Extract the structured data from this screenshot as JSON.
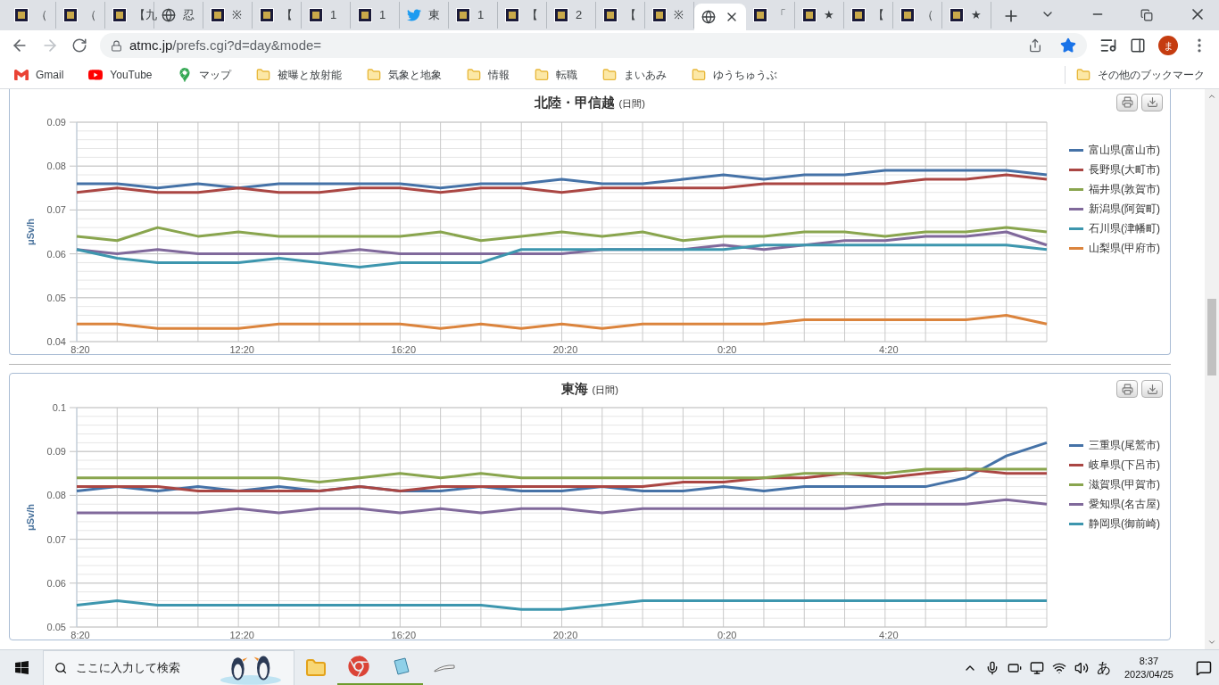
{
  "tabs": [
    {
      "kind": "site",
      "label": "（",
      "selected": false
    },
    {
      "kind": "site",
      "label": "（",
      "selected": false
    },
    {
      "kind": "site",
      "label": "【九",
      "selected": false
    },
    {
      "kind": "globe",
      "label": "忍",
      "selected": false
    },
    {
      "kind": "site",
      "label": "※",
      "selected": false
    },
    {
      "kind": "site",
      "label": "【",
      "selected": false
    },
    {
      "kind": "site",
      "label": "1",
      "selected": false
    },
    {
      "kind": "site",
      "label": "1",
      "selected": false
    },
    {
      "kind": "bird",
      "label": "東",
      "selected": false
    },
    {
      "kind": "site",
      "label": "1",
      "selected": false
    },
    {
      "kind": "site",
      "label": "【",
      "selected": false
    },
    {
      "kind": "site",
      "label": "2",
      "selected": false
    },
    {
      "kind": "site",
      "label": "【",
      "selected": false
    },
    {
      "kind": "site",
      "label": "※",
      "selected": false
    },
    {
      "kind": "globe",
      "selected": true
    },
    {
      "kind": "site",
      "label": "「",
      "selected": false
    },
    {
      "kind": "site",
      "label": "★",
      "selected": false
    },
    {
      "kind": "site",
      "label": "【",
      "selected": false
    },
    {
      "kind": "site",
      "label": "（",
      "selected": false
    },
    {
      "kind": "site",
      "label": "★",
      "selected": false
    }
  ],
  "toolbar": {
    "url_host": "atmc.jp",
    "url_path": "/prefs.cgi?d=day&mode=",
    "bookmarked": true,
    "avatar": "ま"
  },
  "bookmarks": [
    {
      "kind": "gmail",
      "label": "Gmail"
    },
    {
      "kind": "youtube",
      "label": "YouTube"
    },
    {
      "kind": "maps",
      "label": "マップ"
    },
    {
      "kind": "folder",
      "label": "被曝と放射能"
    },
    {
      "kind": "folder",
      "label": "気象と地象"
    },
    {
      "kind": "folder",
      "label": "情報"
    },
    {
      "kind": "folder",
      "label": "転職"
    },
    {
      "kind": "folder",
      "label": "まいあみ"
    },
    {
      "kind": "folder",
      "label": "ゆうちゅうぶ"
    }
  ],
  "other_bookmarks": "その他のブックマーク",
  "charts": [
    {
      "title": "北陸・甲信越",
      "period": "(日間)",
      "chart_data": {
        "type": "line",
        "ylabel": "μSv/h",
        "categories": [
          "8:20",
          null,
          null,
          null,
          "12:20",
          null,
          null,
          null,
          "16:20",
          null,
          null,
          null,
          "20:20",
          null,
          null,
          null,
          "0:20",
          null,
          null,
          null,
          "4:20",
          null,
          null,
          null,
          null
        ],
        "ylim": [
          0.04,
          0.09
        ],
        "grid": true,
        "legend": "right",
        "yticks": [
          0.04,
          0.05,
          0.06,
          0.07,
          0.08,
          0.09
        ],
        "series": [
          {
            "name": "富山県(富山市)",
            "color": "#4572a7",
            "values": [
              0.076,
              0.076,
              0.075,
              0.076,
              0.075,
              0.076,
              0.076,
              0.076,
              0.076,
              0.075,
              0.076,
              0.076,
              0.077,
              0.076,
              0.076,
              0.077,
              0.078,
              0.077,
              0.078,
              0.078,
              0.079,
              0.079,
              0.079,
              0.079,
              0.078
            ]
          },
          {
            "name": "長野県(大町市)",
            "color": "#aa4643",
            "values": [
              0.074,
              0.075,
              0.074,
              0.074,
              0.075,
              0.074,
              0.074,
              0.075,
              0.075,
              0.074,
              0.075,
              0.075,
              0.074,
              0.075,
              0.075,
              0.075,
              0.075,
              0.076,
              0.076,
              0.076,
              0.076,
              0.077,
              0.077,
              0.078,
              0.077
            ]
          },
          {
            "name": "福井県(敦賀市)",
            "color": "#89a54e",
            "values": [
              0.064,
              0.063,
              0.066,
              0.064,
              0.065,
              0.064,
              0.064,
              0.064,
              0.064,
              0.065,
              0.063,
              0.064,
              0.065,
              0.064,
              0.065,
              0.063,
              0.064,
              0.064,
              0.065,
              0.065,
              0.064,
              0.065,
              0.065,
              0.066,
              0.065
            ]
          },
          {
            "name": "新潟県(阿賀町)",
            "color": "#80699b",
            "values": [
              0.061,
              0.06,
              0.061,
              0.06,
              0.06,
              0.06,
              0.06,
              0.061,
              0.06,
              0.06,
              0.06,
              0.06,
              0.06,
              0.061,
              0.061,
              0.061,
              0.062,
              0.061,
              0.062,
              0.063,
              0.063,
              0.064,
              0.064,
              0.065,
              0.062
            ]
          },
          {
            "name": "石川県(津幡町)",
            "color": "#3d96ae",
            "values": [
              0.061,
              0.059,
              0.058,
              0.058,
              0.058,
              0.059,
              0.058,
              0.057,
              0.058,
              0.058,
              0.058,
              0.061,
              0.061,
              0.061,
              0.061,
              0.061,
              0.061,
              0.062,
              0.062,
              0.062,
              0.062,
              0.062,
              0.062,
              0.062,
              0.061
            ]
          },
          {
            "name": "山梨県(甲府市)",
            "color": "#db843d",
            "values": [
              0.044,
              0.044,
              0.043,
              0.043,
              0.043,
              0.044,
              0.044,
              0.044,
              0.044,
              0.043,
              0.044,
              0.043,
              0.044,
              0.043,
              0.044,
              0.044,
              0.044,
              0.044,
              0.045,
              0.045,
              0.045,
              0.045,
              0.045,
              0.046,
              0.044
            ]
          }
        ]
      }
    },
    {
      "title": "東海",
      "period": "(日間)",
      "chart_data": {
        "type": "line",
        "ylabel": "μSv/h",
        "categories": [
          "8:20",
          null,
          null,
          null,
          "12:20",
          null,
          null,
          null,
          "16:20",
          null,
          null,
          null,
          "20:20",
          null,
          null,
          null,
          "0:20",
          null,
          null,
          null,
          "4:20",
          null,
          null,
          null,
          null
        ],
        "ylim": [
          0.05,
          0.1
        ],
        "grid": true,
        "legend": "right",
        "yticks": [
          0.05,
          0.06,
          0.07,
          0.08,
          0.09,
          0.1
        ],
        "series": [
          {
            "name": "三重県(尾鷲市)",
            "color": "#4572a7",
            "values": [
              0.081,
              0.082,
              0.081,
              0.082,
              0.081,
              0.082,
              0.081,
              0.082,
              0.081,
              0.081,
              0.082,
              0.081,
              0.081,
              0.082,
              0.081,
              0.081,
              0.082,
              0.081,
              0.082,
              0.082,
              0.082,
              0.082,
              0.084,
              0.089,
              0.092
            ]
          },
          {
            "name": "岐阜県(下呂市)",
            "color": "#aa4643",
            "values": [
              0.082,
              0.082,
              0.082,
              0.081,
              0.081,
              0.081,
              0.081,
              0.082,
              0.081,
              0.082,
              0.082,
              0.082,
              0.082,
              0.082,
              0.082,
              0.083,
              0.083,
              0.084,
              0.084,
              0.085,
              0.084,
              0.085,
              0.086,
              0.085,
              0.085
            ]
          },
          {
            "name": "滋賀県(甲賀市)",
            "color": "#89a54e",
            "values": [
              0.084,
              0.084,
              0.084,
              0.084,
              0.084,
              0.084,
              0.083,
              0.084,
              0.085,
              0.084,
              0.085,
              0.084,
              0.084,
              0.084,
              0.084,
              0.084,
              0.084,
              0.084,
              0.085,
              0.085,
              0.085,
              0.086,
              0.086,
              0.086,
              0.086
            ]
          },
          {
            "name": "愛知県(名古屋)",
            "color": "#80699b",
            "values": [
              0.076,
              0.076,
              0.076,
              0.076,
              0.077,
              0.076,
              0.077,
              0.077,
              0.076,
              0.077,
              0.076,
              0.077,
              0.077,
              0.076,
              0.077,
              0.077,
              0.077,
              0.077,
              0.077,
              0.077,
              0.078,
              0.078,
              0.078,
              0.079,
              0.078
            ]
          },
          {
            "name": "静岡県(御前崎)",
            "color": "#3d96ae",
            "values": [
              0.055,
              0.056,
              0.055,
              0.055,
              0.055,
              0.055,
              0.055,
              0.055,
              0.055,
              0.055,
              0.055,
              0.054,
              0.054,
              0.055,
              0.056,
              0.056,
              0.056,
              0.056,
              0.056,
              0.056,
              0.056,
              0.056,
              0.056,
              0.056,
              0.056
            ]
          }
        ]
      }
    }
  ],
  "taskbar": {
    "search_placeholder": "ここに入力して検索",
    "apps": [
      {
        "kind": "explorer",
        "active": false
      },
      {
        "kind": "chrome",
        "active": true
      },
      {
        "kind": "notepad",
        "active": true
      },
      {
        "kind": "pen",
        "active": false
      }
    ],
    "ime": "あ",
    "time": "8:37",
    "date": "2023/04/25"
  }
}
